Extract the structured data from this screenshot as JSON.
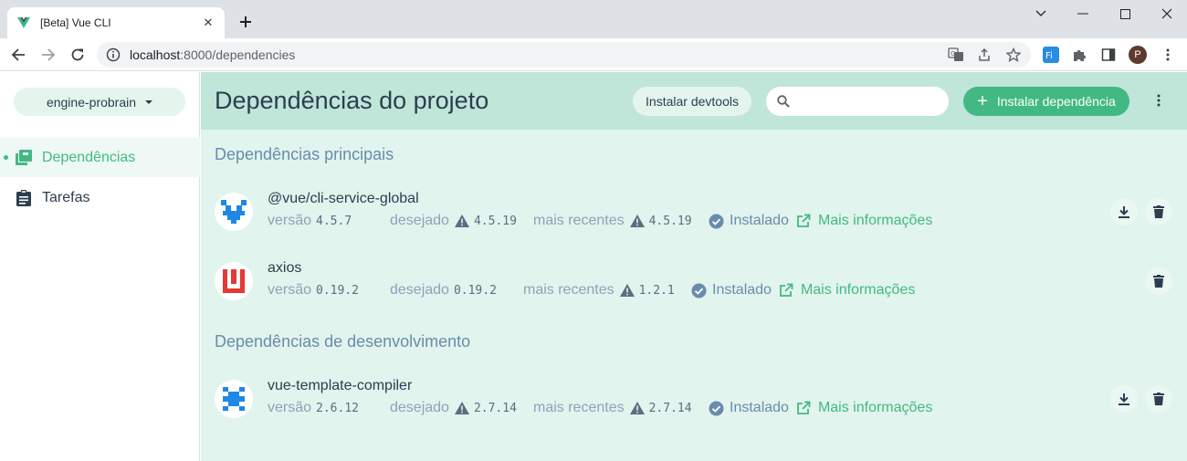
{
  "browser": {
    "tab_title": "[Beta] Vue CLI",
    "url_host": "localhost",
    "url_rest": ":8000/dependencies",
    "avatar_letter": "P"
  },
  "sidebar": {
    "project": "engine-probrain",
    "items": [
      {
        "label": "Dependências",
        "active": true
      },
      {
        "label": "Tarefas",
        "active": false
      }
    ]
  },
  "header": {
    "title": "Dependências do projeto",
    "devtools_label": "Instalar devtools",
    "search_placeholder": "",
    "install_label": "Instalar dependência"
  },
  "sections": {
    "main_title": "Dependências principais",
    "dev_title": "Dependências de desenvolvimento"
  },
  "labels": {
    "version": "versão",
    "wanted": "desejado",
    "latest": "mais recentes",
    "installed": "Instalado",
    "more_info": "Mais informações"
  },
  "dependencies": [
    {
      "name": "@vue/cli-service-global",
      "version": "4.5.7",
      "wanted": "4.5.19",
      "latest": "4.5.19"
    },
    {
      "name": "axios",
      "version": "0.19.2",
      "wanted": "0.19.2",
      "latest": "1.2.1"
    },
    {
      "name": "vue-template-compiler",
      "version": "2.6.12",
      "wanted": "2.7.14",
      "latest": "2.7.14"
    }
  ],
  "colors": {
    "accent": "#42b983",
    "header_bg": "#bfe6d8",
    "content_bg": "#e1f4ed",
    "text": "#2c3e50",
    "muted": "#6a8bad"
  },
  "icons": {
    "sidebar": [
      "library-icon",
      "clipboard-icon"
    ],
    "actions": [
      "download-icon",
      "delete-icon"
    ]
  }
}
